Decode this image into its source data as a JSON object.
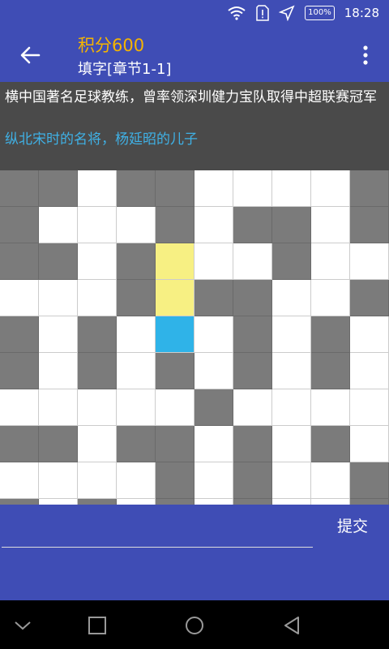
{
  "status_bar": {
    "battery": "100%",
    "time": "18:28"
  },
  "header": {
    "score": "积分600",
    "subtitle": "填字[章节1-1]"
  },
  "clues": {
    "horizontal": "横中国著名足球教练，曾率领深圳健力宝队取得中超联赛冠军",
    "vertical": "纵北宋时的名将，杨延昭的儿子"
  },
  "grid": {
    "rows": [
      "ggwggwwwwg",
      "gwwwgwggwg",
      "ggwgywwgww",
      "wwwgyggwwg",
      "gwgwbwgwgw",
      "gwgwgwgwgw",
      "wwwwwgwwww",
      "ggwggwgwgw",
      "wwwwgwgwwg",
      "gwgwgwgwwg"
    ]
  },
  "input": {
    "value": "",
    "placeholder": ""
  },
  "actions": {
    "submit_label": "提交"
  },
  "colors": {
    "primary": "#3f4db5",
    "score": "#f5b400",
    "highlight_vertical": "#2fb3e8",
    "selected_word": "#f7f083",
    "blocked_cell": "#7b7b7b"
  }
}
